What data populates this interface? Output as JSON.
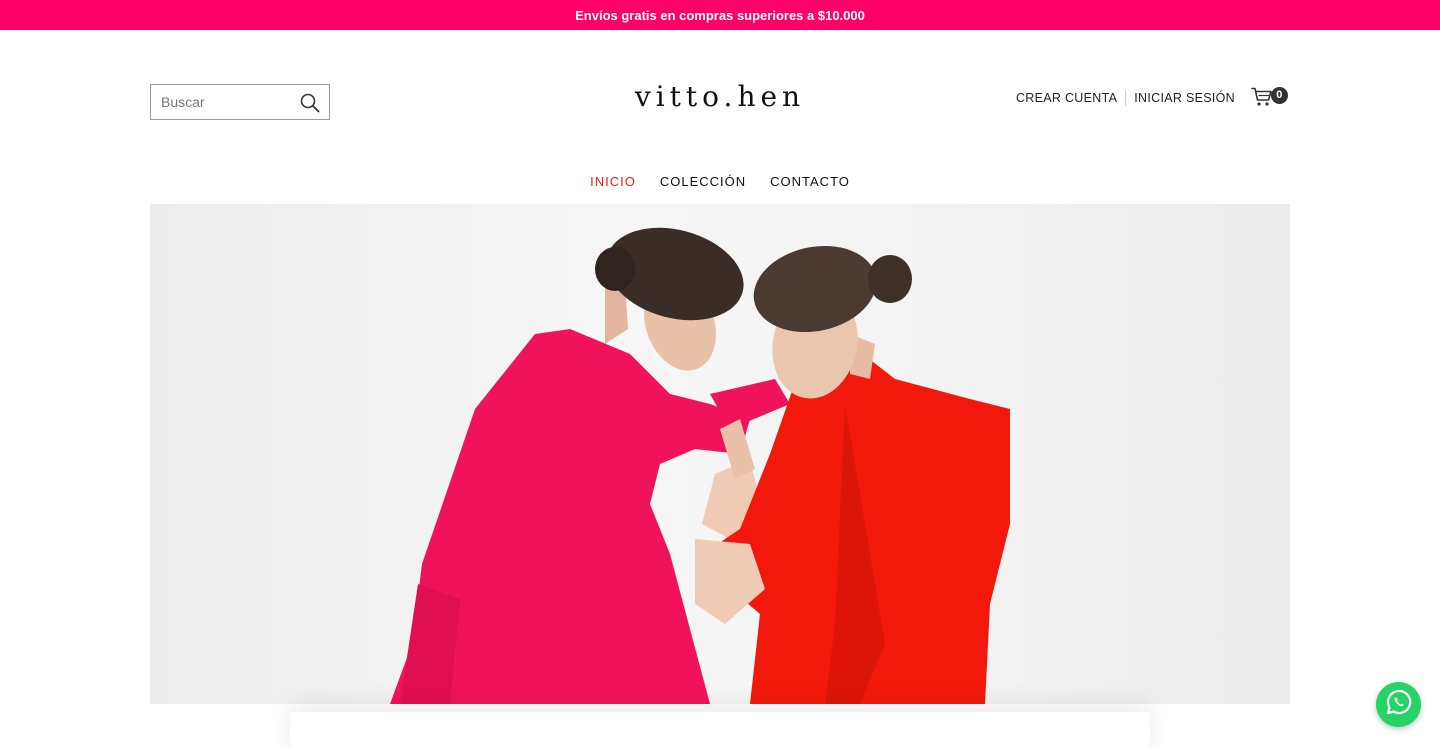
{
  "promo": {
    "text": "Envíos gratis en compras superiores a $10.000",
    "bg_color": "#ff0068"
  },
  "header": {
    "logo_text": "vitto.hen",
    "search": {
      "placeholder": "Buscar",
      "value": "",
      "icon": "search-icon"
    },
    "account": {
      "create_account_label": "CREAR CUENTA",
      "login_label": "INICIAR SESIÓN"
    },
    "cart": {
      "icon": "cart-icon",
      "count": "0"
    }
  },
  "nav": {
    "items": [
      {
        "label": "INICIO",
        "active": true
      },
      {
        "label": "COLECCIÓN",
        "active": false
      },
      {
        "label": "CONTACTO",
        "active": false
      }
    ],
    "active_color": "#e42313"
  },
  "hero": {
    "image": "hero-image",
    "colors": {
      "pink_dress": "#f0125a",
      "red_dress": "#f2190c",
      "background": "#f3f3f3"
    }
  },
  "floating": {
    "whatsapp": {
      "icon": "whatsapp-icon",
      "color": "#25d366"
    }
  }
}
